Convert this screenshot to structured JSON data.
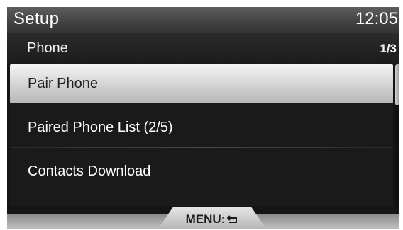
{
  "header": {
    "title": "Setup",
    "time": "12:05"
  },
  "subheader": {
    "title": "Phone",
    "page": "1/3"
  },
  "menu": {
    "items": [
      {
        "label": "Pair Phone",
        "selected": true
      },
      {
        "label": "Paired Phone List (2/5)",
        "selected": false
      },
      {
        "label": "Contacts Download",
        "selected": false
      }
    ]
  },
  "footer": {
    "menu_label": "MENU:",
    "menu_icon": "back-arrow-icon"
  },
  "colors": {
    "screen_bg": "#151515",
    "selected_bg": "#d2d2d2",
    "text": "#ffffff",
    "selected_text": "#222222"
  }
}
